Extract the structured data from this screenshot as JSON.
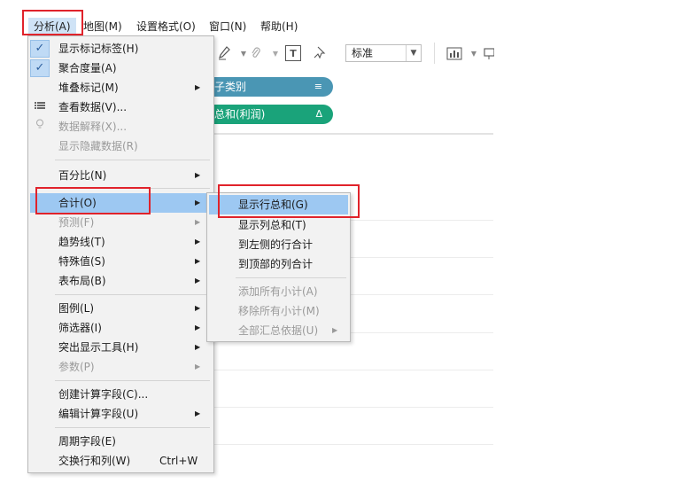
{
  "menubar": {
    "items": [
      "分析(A)",
      "地图(M)",
      "设置格式(O)",
      "窗口(N)",
      "帮助(H)"
    ]
  },
  "toolbar": {
    "text_button": "T",
    "pin_icon": "pin-icon",
    "size_select": "标准",
    "select_arrow": "▼",
    "chart_icon": "bar-chart-icon"
  },
  "shelves": {
    "columns_pill": "子类别",
    "columns_pill_mark": "≡",
    "rows_pill": "总和(利润)",
    "rows_pill_mark": "Δ",
    "colors": {
      "dimension": "#4a96b4",
      "measure": "#1aa37a"
    }
  },
  "analysis_menu": {
    "items": [
      {
        "label": "显示标记标签(H)",
        "checked": true
      },
      {
        "label": "聚合度量(A)",
        "checked": true
      },
      {
        "label": "堆叠标记(M)",
        "submenu": true
      },
      {
        "label": "查看数据(V)...",
        "icon": "table-icon"
      },
      {
        "label": "数据解释(X)...",
        "icon": "bulb-icon",
        "disabled": true
      },
      {
        "label": "显示隐藏数据(R)",
        "disabled": true
      },
      {
        "label": "百分比(N)",
        "submenu": true
      },
      {
        "label": "合计(O)",
        "submenu": true,
        "highlighted": true
      },
      {
        "label": "预测(F)",
        "submenu": true,
        "disabled": true
      },
      {
        "label": "趋势线(T)",
        "submenu": true
      },
      {
        "label": "特殊值(S)",
        "submenu": true
      },
      {
        "label": "表布局(B)",
        "submenu": true
      },
      {
        "label": "图例(L)",
        "submenu": true
      },
      {
        "label": "筛选器(I)",
        "submenu": true
      },
      {
        "label": "突出显示工具(H)",
        "submenu": true
      },
      {
        "label": "参数(P)",
        "submenu": true,
        "disabled": true
      },
      {
        "label": "创建计算字段(C)..."
      },
      {
        "label": "编辑计算字段(U)",
        "submenu": true
      },
      {
        "label": "周期字段(E)"
      },
      {
        "label": "交换行和列(W)",
        "shortcut": "Ctrl+W"
      }
    ]
  },
  "totals_submenu": {
    "items": [
      {
        "label": "显示行总和(G)",
        "highlighted": true
      },
      {
        "label": "显示列总和(T)"
      },
      {
        "label": "到左侧的行合计"
      },
      {
        "label": "到顶部的列合计"
      },
      {
        "label": "添加所有小计(A)",
        "disabled": true
      },
      {
        "label": "移除所有小计(M)",
        "disabled": true
      },
      {
        "label": "全部汇总依据(U)",
        "submenu": true,
        "disabled": true
      }
    ]
  },
  "glyphs": {
    "check": "✓",
    "arrow": "▶"
  },
  "colors": {
    "highlight": "#9dc8f2",
    "annotation_box": "#e0232b",
    "menu_bg": "#f2f2f2"
  }
}
